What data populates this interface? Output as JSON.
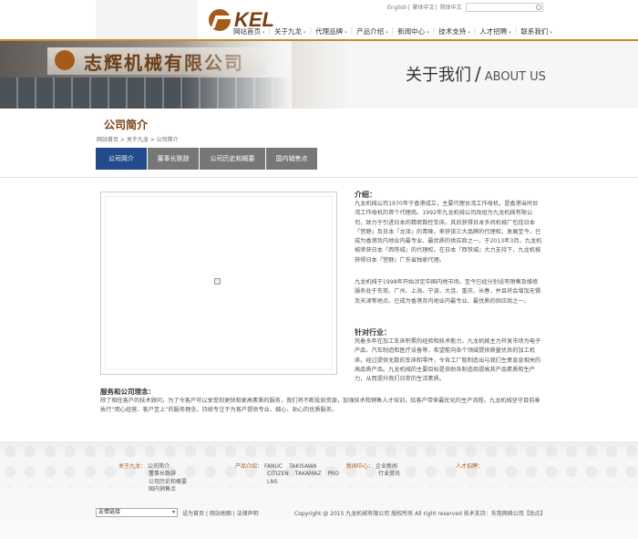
{
  "header": {
    "logo_text": "KEL",
    "langs": [
      "English",
      "繁体中文",
      "简体中文"
    ],
    "search_placeholder": "",
    "nav": [
      "网站首页",
      "关于九龙",
      "代理品牌",
      "产品介绍",
      "新闻中心",
      "技术支持",
      "人才招聘",
      "联系我们"
    ]
  },
  "banner": {
    "sign_text": "志辉机械有限公司",
    "title_cn": "关于我们",
    "slash": "/",
    "title_en": "ABOUT US"
  },
  "section": {
    "title": "公司简介",
    "breadcrumb": "网站首页 > 关于九龙 > 公司简介",
    "tabs": [
      "公司简介",
      "董事长致辞",
      "公司历史和概要",
      "国内销售点"
    ]
  },
  "content": {
    "intro_heading": "介绍：",
    "p1": "九龙机械公司1970年于香港成立，主要代理台湾工作母机，是香港当时台湾工作母机的首个代理商。1992年九龙机械公司改组为九龙机械有限公司，致力于引进日本的精密数控车床。其后获得日本多间机械厂包括日本『宫野』及日本『龙泽』的青睐，来获该三大品牌的代理权。发展至今，已成为香港及内地业内最专业、最优质的供应商之一。于2013年3月，九龙机械荣获日本『西铁城』的代理权。在日本『西铁城』大力支持下，九龙机械获得日本『宫野』广东省独家代理。",
    "p2": "九龙机械于1998年开始涉足中国内地市场。至今已经分别设有销售及维修服务处于东莞、广州、上海、宁波、大连、重庆、长春，并且将会增加无锡及天津等地点。已成为香港及内地业内最专业、最优质的供应商之一。",
    "industry_heading": "针对行业：",
    "p3": "凭着多年在加工车床积累的经验和技术能力，九龙机械主力开发市场为电子产品、汽车制造和医疗设备等，希望能向各个领域提供质量优良的加工机床。经过提供无数的车床和零件，令各工厂能制造出与我们生意息息相关的高品质产品。九龙机械的主要目标是协助各制造商提高其产品素质和生产力，从而提升我们日常的生活素质。",
    "service_heading": "服务和公司理念：",
    "p4": "除了相任客户的技术顾问，为了令客户可以享受到更快和更高素质的服务，我们将不断投放资源，加强技术和销售人才培训，给客户带来最优化的生产流程。九龙机械坚守目前奉执行“用心经营、客户至上”的服务理念，持续专注于为客户提供专业、细心、贴心的优质服务。"
  },
  "footer": {
    "about_label": "关于九龙：",
    "about_items": [
      "公司简介",
      "董事长致辞",
      "公司历史和概要",
      "国内销售点"
    ],
    "products_label": "产品介绍：",
    "products": [
      "FANUC",
      "TAKISAWA",
      "CITIZEN",
      "TAKAMAZ",
      "PRO",
      "LNS"
    ],
    "news_label": "新闻中心：",
    "news_items": [
      "企业新闻",
      "行业资讯"
    ],
    "jobs_label": "人才招聘：",
    "friend_links": "友情链接",
    "links": "设为首页 | 网站地图 | 法律声明",
    "copyright": "Copyright @ 2015 九龙机械有限公司 版权所有 All right reserved 技术支持：东莞网络公司【劲点】"
  }
}
